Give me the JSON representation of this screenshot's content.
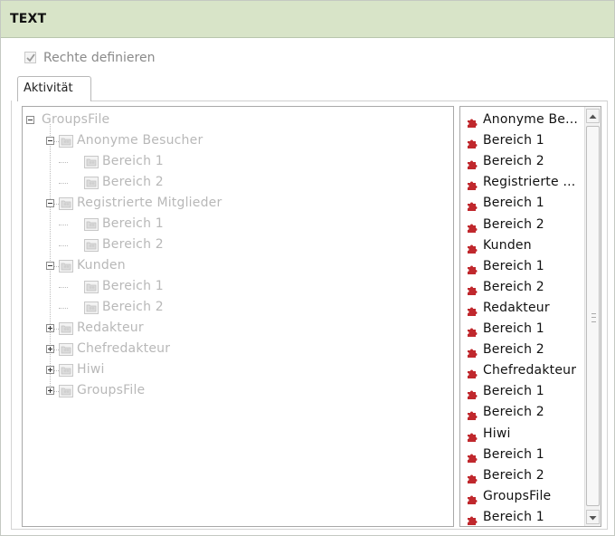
{
  "panel": {
    "title": "TEXT"
  },
  "permissions": {
    "define_rights_label": "Rechte definieren",
    "define_rights_checked": true
  },
  "tabs": [
    {
      "label": "Aktivität",
      "active": true
    }
  ],
  "tree": {
    "nodes": [
      {
        "label": "GroupsFile",
        "level": 0,
        "toggle": "minus"
      },
      {
        "label": "Anonyme Besucher",
        "level": 1,
        "toggle": "minus"
      },
      {
        "label": "Bereich 1",
        "level": 2,
        "toggle": "none"
      },
      {
        "label": "Bereich 2",
        "level": 2,
        "toggle": "none"
      },
      {
        "label": "Registrierte Mitglieder",
        "level": 1,
        "toggle": "minus"
      },
      {
        "label": "Bereich 1",
        "level": 2,
        "toggle": "none"
      },
      {
        "label": "Bereich 2",
        "level": 2,
        "toggle": "none"
      },
      {
        "label": "Kunden",
        "level": 1,
        "toggle": "minus"
      },
      {
        "label": "Bereich 1",
        "level": 2,
        "toggle": "none"
      },
      {
        "label": "Bereich 2",
        "level": 2,
        "toggle": "none"
      },
      {
        "label": "Redakteur",
        "level": 1,
        "toggle": "plus"
      },
      {
        "label": "Chefredakteur",
        "level": 1,
        "toggle": "plus"
      },
      {
        "label": "Hiwi",
        "level": 1,
        "toggle": "plus"
      },
      {
        "label": "GroupsFile",
        "level": 1,
        "toggle": "plus"
      }
    ]
  },
  "list": {
    "icon": "puzzle-piece-icon",
    "icon_color": "#c0282d",
    "items": [
      "Anonyme Be...",
      "Bereich 1",
      "Bereich 2",
      "Registrierte ...",
      "Bereich 1",
      "Bereich 2",
      "Kunden",
      "Bereich 1",
      "Bereich 2",
      "Redakteur",
      "Bereich 1",
      "Bereich 2",
      "Chefredakteur",
      "Bereich 1",
      "Bereich 2",
      "Hiwi",
      "Bereich 1",
      "Bereich 2",
      "GroupsFile",
      "Bereich 1"
    ]
  },
  "colors": {
    "title_bar": "#d8e4c8",
    "disabled_text": "#b8b8b8"
  }
}
